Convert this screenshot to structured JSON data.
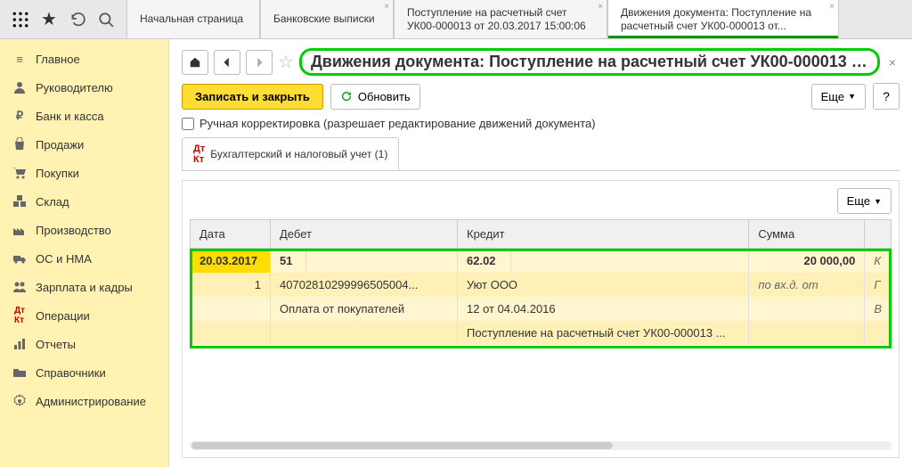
{
  "topbar": {
    "tabs": [
      {
        "label": "Начальная страница",
        "closable": false
      },
      {
        "label": "Банковские выписки",
        "closable": true
      },
      {
        "label": "Поступление на расчетный счет УК00-000013 от 20.03.2017 15:00:06",
        "closable": true
      },
      {
        "label": "Движения документа: Поступление на расчетный счет УК00-000013 от...",
        "closable": true,
        "active": true
      }
    ]
  },
  "sidebar": {
    "items": [
      {
        "label": "Главное",
        "icon": "menu"
      },
      {
        "label": "Руководителю",
        "icon": "person"
      },
      {
        "label": "Банк и касса",
        "icon": "ruble"
      },
      {
        "label": "Продажи",
        "icon": "bag"
      },
      {
        "label": "Покупки",
        "icon": "cart"
      },
      {
        "label": "Склад",
        "icon": "boxes"
      },
      {
        "label": "Производство",
        "icon": "factory"
      },
      {
        "label": "ОС и НМА",
        "icon": "truck"
      },
      {
        "label": "Зарплата и кадры",
        "icon": "people"
      },
      {
        "label": "Операции",
        "icon": "dkt"
      },
      {
        "label": "Отчеты",
        "icon": "chart"
      },
      {
        "label": "Справочники",
        "icon": "folder"
      },
      {
        "label": "Администрирование",
        "icon": "gear"
      }
    ]
  },
  "page": {
    "title": "Движения документа: Поступление на расчетный счет УК00-000013 о...",
    "save_close": "Записать и закрыть",
    "refresh": "Обновить",
    "more": "Еще",
    "manual_edit": "Ручная корректировка (разрешает редактирование движений документа)",
    "subtab": "Бухгалтерский и налоговый учет (1)"
  },
  "table": {
    "headers": {
      "date": "Дата",
      "debit": "Дебет",
      "credit": "Кредит",
      "sum": "Сумма"
    },
    "more": "Еще",
    "rows": [
      {
        "date": "20.03.2017",
        "n": "1",
        "debit_acc": "51",
        "debit_sub1": "40702810299996505004...",
        "debit_sub2": "Оплата от покупателей",
        "credit_acc": "62.02",
        "credit_sub1": "Уют ООО",
        "credit_sub2": "12 от 04.04.2016",
        "credit_sub3": "Поступление на расчетный счет УК00-000013 ...",
        "sum": "20 000,00",
        "note": "по вх.д.  от",
        "ex1": "К",
        "ex2": "Г",
        "ex3": "В"
      }
    ]
  }
}
